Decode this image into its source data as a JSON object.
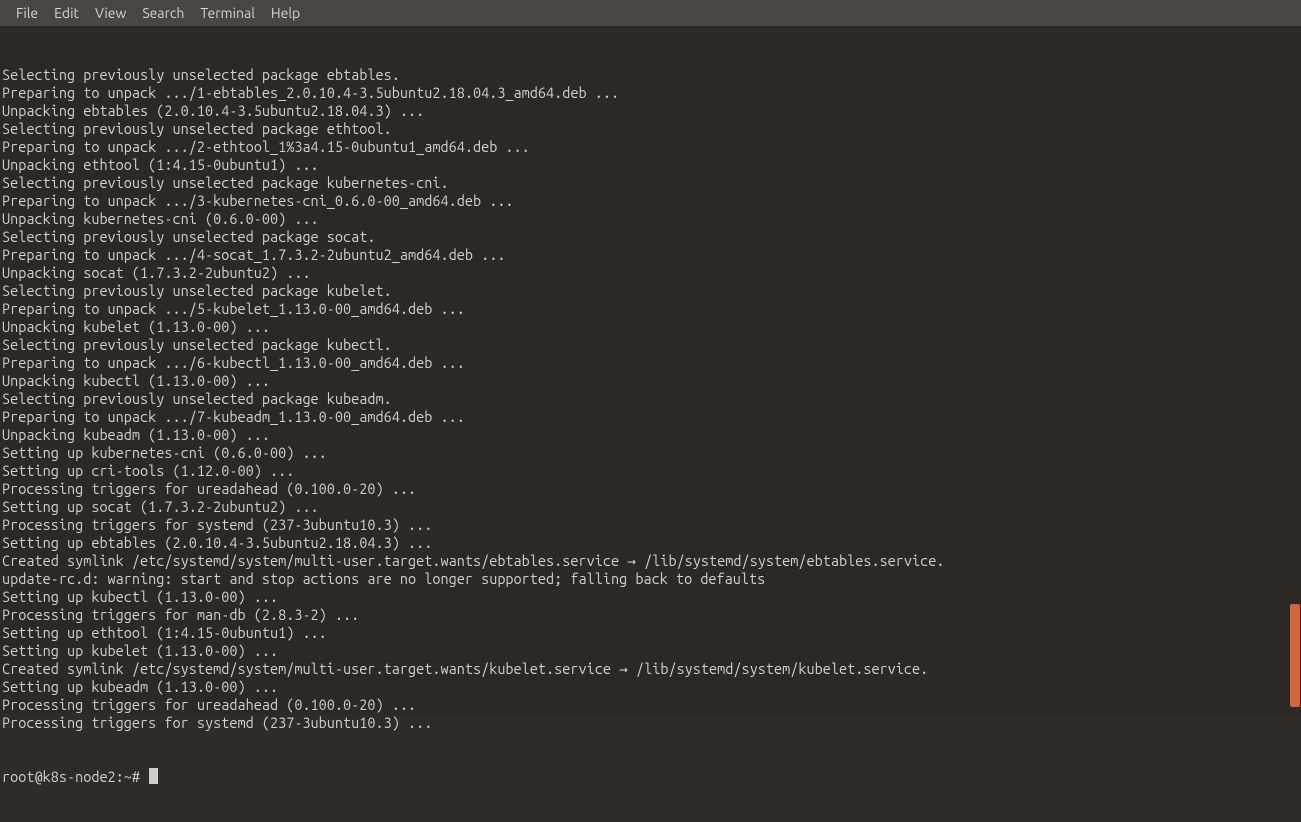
{
  "menubar": {
    "items": [
      "File",
      "Edit",
      "View",
      "Search",
      "Terminal",
      "Help"
    ]
  },
  "terminal": {
    "lines": [
      "Selecting previously unselected package ebtables.",
      "Preparing to unpack .../1-ebtables_2.0.10.4-3.5ubuntu2.18.04.3_amd64.deb ...",
      "Unpacking ebtables (2.0.10.4-3.5ubuntu2.18.04.3) ...",
      "Selecting previously unselected package ethtool.",
      "Preparing to unpack .../2-ethtool_1%3a4.15-0ubuntu1_amd64.deb ...",
      "Unpacking ethtool (1:4.15-0ubuntu1) ...",
      "Selecting previously unselected package kubernetes-cni.",
      "Preparing to unpack .../3-kubernetes-cni_0.6.0-00_amd64.deb ...",
      "Unpacking kubernetes-cni (0.6.0-00) ...",
      "Selecting previously unselected package socat.",
      "Preparing to unpack .../4-socat_1.7.3.2-2ubuntu2_amd64.deb ...",
      "Unpacking socat (1.7.3.2-2ubuntu2) ...",
      "Selecting previously unselected package kubelet.",
      "Preparing to unpack .../5-kubelet_1.13.0-00_amd64.deb ...",
      "Unpacking kubelet (1.13.0-00) ...",
      "Selecting previously unselected package kubectl.",
      "Preparing to unpack .../6-kubectl_1.13.0-00_amd64.deb ...",
      "Unpacking kubectl (1.13.0-00) ...",
      "Selecting previously unselected package kubeadm.",
      "Preparing to unpack .../7-kubeadm_1.13.0-00_amd64.deb ...",
      "Unpacking kubeadm (1.13.0-00) ...",
      "Setting up kubernetes-cni (0.6.0-00) ...",
      "Setting up cri-tools (1.12.0-00) ...",
      "Processing triggers for ureadahead (0.100.0-20) ...",
      "Setting up socat (1.7.3.2-2ubuntu2) ...",
      "Processing triggers for systemd (237-3ubuntu10.3) ...",
      "Setting up ebtables (2.0.10.4-3.5ubuntu2.18.04.3) ...",
      "Created symlink /etc/systemd/system/multi-user.target.wants/ebtables.service → /lib/systemd/system/ebtables.service.",
      "update-rc.d: warning: start and stop actions are no longer supported; falling back to defaults",
      "Setting up kubectl (1.13.0-00) ...",
      "Processing triggers for man-db (2.8.3-2) ...",
      "Setting up ethtool (1:4.15-0ubuntu1) ...",
      "Setting up kubelet (1.13.0-00) ...",
      "Created symlink /etc/systemd/system/multi-user.target.wants/kubelet.service → /lib/systemd/system/kubelet.service.",
      "Setting up kubeadm (1.13.0-00) ...",
      "Processing triggers for ureadahead (0.100.0-20) ...",
      "Processing triggers for systemd (237-3ubuntu10.3) ..."
    ],
    "prompt": "root@k8s-node2:~# "
  },
  "scrollbar": {
    "thumb_top_pct": 84,
    "thumb_height_pct": 15
  }
}
